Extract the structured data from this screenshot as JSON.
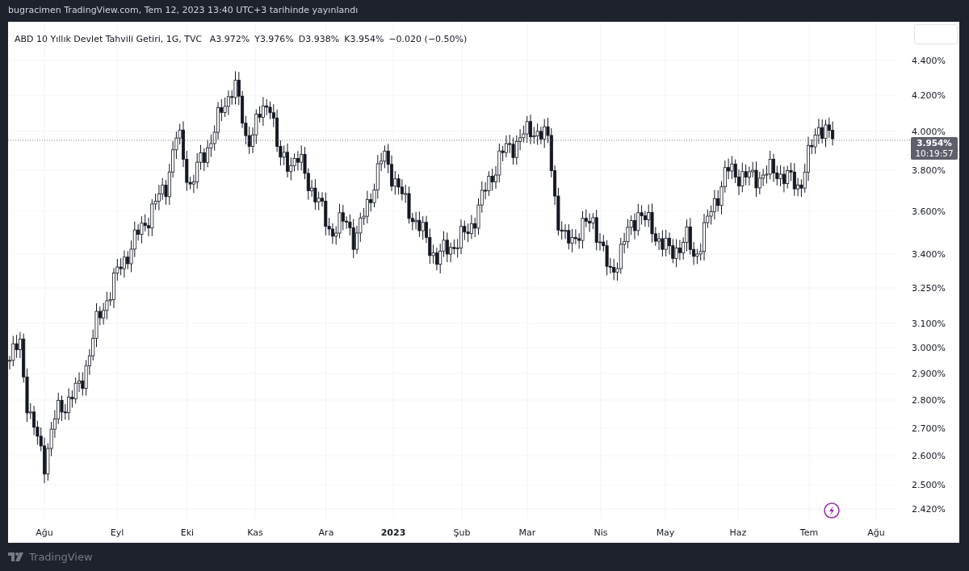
{
  "header": {
    "published": "bugracimen TradingView.com, Tem 12, 2023 13:40 UTC+3 tarihinde yayınlandı"
  },
  "legend": {
    "symbol": "ABD 10 Yıllık Devlet Tahvili Getiri, 1G, TVC",
    "open": "A3.972%",
    "high": "Y3.976%",
    "low": "D3.938%",
    "close": "K3.954%",
    "change": "−0.020 (−0.50%)"
  },
  "price_axis": {
    "ticks": [
      "4.400%",
      "4.200%",
      "4.000%",
      "3.800%",
      "3.600%",
      "3.400%",
      "3.250%",
      "3.100%",
      "3.000%",
      "2.900%",
      "2.800%",
      "2.700%",
      "2.600%",
      "2.500%",
      "2.420%"
    ]
  },
  "last_price": {
    "value": "3.954%",
    "countdown": "10:19:57"
  },
  "time_axis": {
    "labels": [
      {
        "text": "Ağu",
        "kind": "month"
      },
      {
        "text": "Eyl",
        "kind": "month"
      },
      {
        "text": "Eki",
        "kind": "month"
      },
      {
        "text": "Kas",
        "kind": "month"
      },
      {
        "text": "Ara",
        "kind": "month"
      },
      {
        "text": "2023",
        "kind": "year"
      },
      {
        "text": "Şub",
        "kind": "month"
      },
      {
        "text": "Mar",
        "kind": "month"
      },
      {
        "text": "Nis",
        "kind": "month"
      },
      {
        "text": "May",
        "kind": "month"
      },
      {
        "text": "Haz",
        "kind": "month"
      },
      {
        "text": "Tem",
        "kind": "month"
      },
      {
        "text": "Ağu",
        "kind": "month"
      }
    ]
  },
  "footer": {
    "brand": "TradingView"
  }
}
